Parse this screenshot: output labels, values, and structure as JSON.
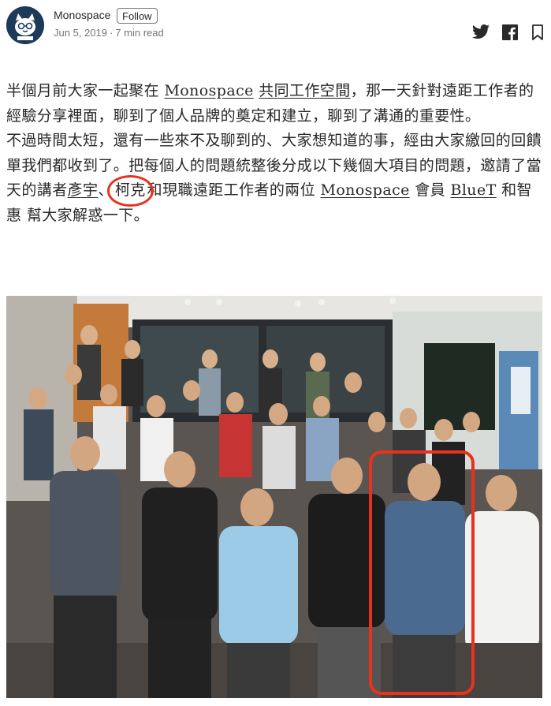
{
  "header": {
    "publication": "Monospace",
    "follow_label": "Follow",
    "date": "Jun 5, 2019",
    "separator": "·",
    "read_time": "7 min read",
    "share_icons": [
      "twitter-icon",
      "facebook-icon",
      "bookmark-icon"
    ]
  },
  "article": {
    "p1": {
      "t1": "半個月前大家一起聚在 ",
      "link1": "Monospace",
      "t2": " ",
      "link2": "共同工作空間",
      "t3": "，那一天針對遠距工作者的經驗分享裡面，聊到了個人品牌的奠定和建立，聊到了溝通的重要性。"
    },
    "p2": {
      "t1": "不過時間太短，還有一些來不及聊到的、大家想知道的事，經由大家繳回的回饋單我們都收到了。把每個人的問題統整後分成以下幾個大項目的問題，邀請了當天的講者",
      "link1": "彥宇",
      "t2": "、",
      "circled": "柯克",
      "t3": "和現職遠距工作者的兩位 ",
      "link2": "Monospace",
      "t4": " 會員 ",
      "link3": "BlueT",
      "t5": " 和智惠 幫大家解惑一下。"
    }
  },
  "colors": {
    "text": "#292929",
    "meta": "#757575",
    "annotation_red": "#e8321e",
    "avatar_bg": "#1e3a5a"
  }
}
